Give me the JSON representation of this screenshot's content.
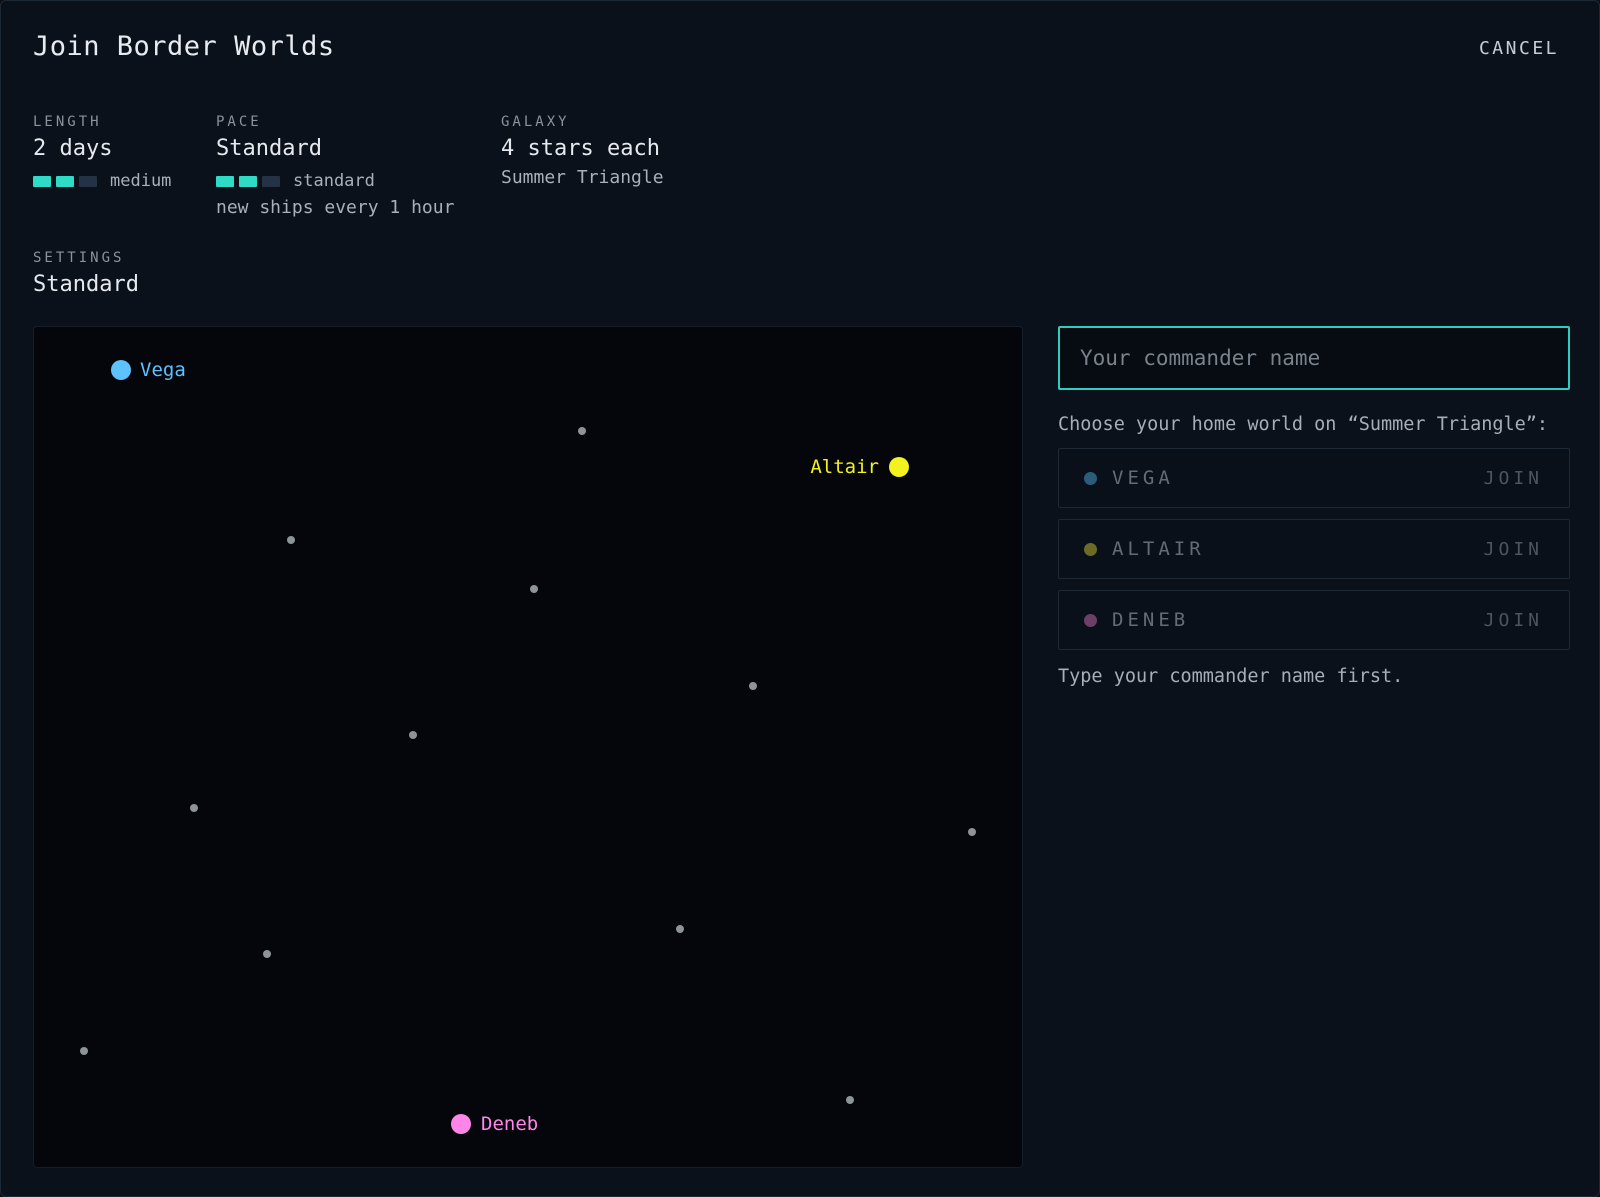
{
  "dialog": {
    "title": "Join Border Worlds",
    "cancel_label": "CANCEL"
  },
  "stats": {
    "length": {
      "label": "LENGTH",
      "value": "2 days",
      "meter_level": 2,
      "meter_max": 3,
      "meter_text": "medium"
    },
    "pace": {
      "label": "PACE",
      "value": "Standard",
      "meter_level": 2,
      "meter_max": 3,
      "meter_text": "standard",
      "note": "new ships every 1 hour"
    },
    "galaxy": {
      "label": "GALAXY",
      "value": "4 stars each",
      "name": "Summer Triangle"
    },
    "settings": {
      "label": "SETTINGS",
      "value": "Standard"
    }
  },
  "map": {
    "home_worlds": [
      {
        "name": "Vega",
        "color": "#5ec2ff"
      },
      {
        "name": "Altair",
        "color": "#f2f21e"
      },
      {
        "name": "Deneb",
        "color": "#ff85e8"
      }
    ],
    "neutral_star_color": "#8e939a"
  },
  "join_panel": {
    "name_placeholder": "Your commander name",
    "name_value": "",
    "choose_text": "Choose your home world on “Summer Triangle”:",
    "worlds": [
      {
        "name": "VEGA",
        "join_label": "JOIN",
        "dot_color": "#2b5d7a"
      },
      {
        "name": "ALTAIR",
        "join_label": "JOIN",
        "dot_color": "#6b6b25"
      },
      {
        "name": "DENEB",
        "join_label": "JOIN",
        "dot_color": "#6c3f66"
      }
    ],
    "hint": "Type your commander name first."
  },
  "colors": {
    "accent": "#2ddbc7",
    "background": "#0b111b"
  }
}
